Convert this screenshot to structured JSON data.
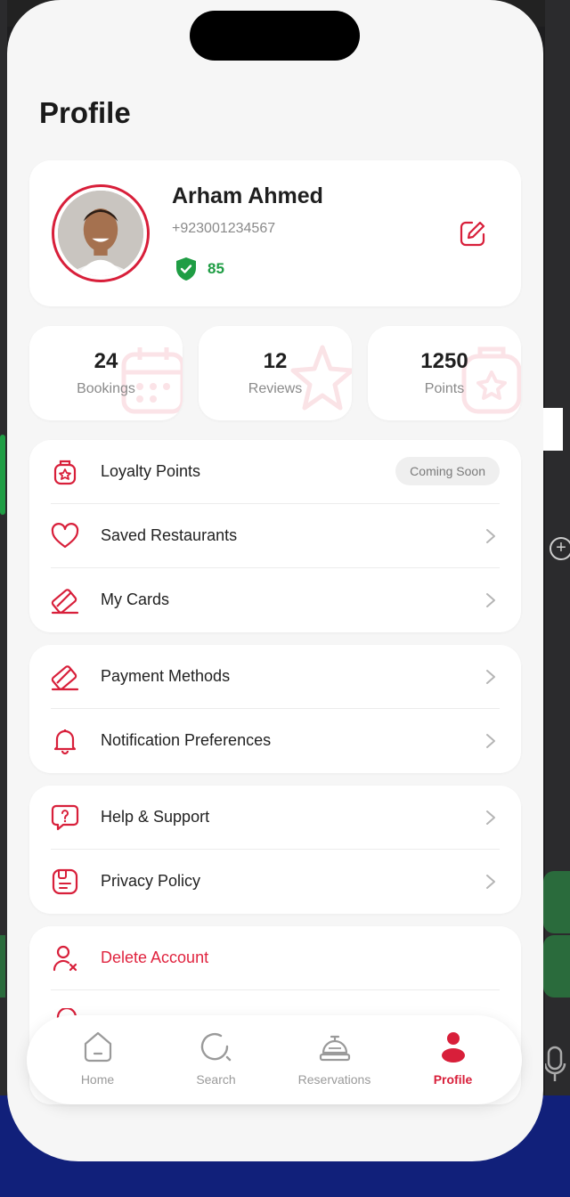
{
  "page": {
    "title": "Profile"
  },
  "profile": {
    "name": "Arham Ahmed",
    "phone": "+923001234567",
    "score": "85"
  },
  "stats": [
    {
      "value": "24",
      "label": "Bookings",
      "icon": "calendar-icon"
    },
    {
      "value": "12",
      "label": "Reviews",
      "icon": "star-icon"
    },
    {
      "value": "1250",
      "label": "Points",
      "icon": "badge-icon"
    }
  ],
  "menu_group_1": [
    {
      "label": "Loyalty Points",
      "icon": "loyalty-icon",
      "badge": "Coming Soon"
    },
    {
      "label": "Saved Restaurants",
      "icon": "heart-icon"
    },
    {
      "label": "My Cards",
      "icon": "card-icon"
    }
  ],
  "menu_group_2": [
    {
      "label": "Payment Methods",
      "icon": "card-icon"
    },
    {
      "label": "Notification Preferences",
      "icon": "bell-icon"
    }
  ],
  "menu_group_3": [
    {
      "label": "Help & Support",
      "icon": "help-icon"
    },
    {
      "label": "Privacy Policy",
      "icon": "document-icon"
    }
  ],
  "menu_group_4": [
    {
      "label": "Delete Account",
      "icon": "delete-user-icon"
    }
  ],
  "tabbar": [
    {
      "label": "Home",
      "icon": "home-icon"
    },
    {
      "label": "Search",
      "icon": "search-icon"
    },
    {
      "label": "Reservations",
      "icon": "reservation-bell-icon"
    },
    {
      "label": "Profile",
      "icon": "profile-icon",
      "active": true
    }
  ],
  "colors": {
    "accent": "#d81f3a",
    "success": "#1f9d44",
    "background": "#f6f6f6"
  }
}
